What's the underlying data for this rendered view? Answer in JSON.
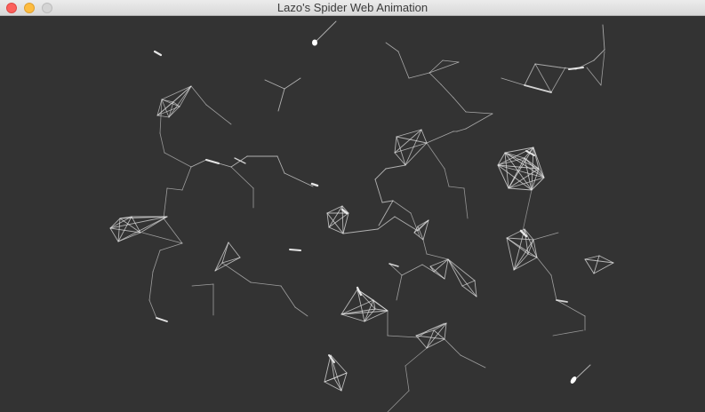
{
  "window": {
    "title": "Lazo's Spider Web Animation",
    "controls": {
      "close": {
        "icon": "close-icon",
        "color": "#fc605c"
      },
      "minimize": {
        "icon": "minimize-icon",
        "color": "#fdbc40"
      },
      "maximize": {
        "icon": "maximize-icon",
        "color": "#d4d4d4"
      }
    }
  },
  "canvas": {
    "background": "#333333",
    "line_color": "#e6e6e6",
    "node_color": "#ffffff"
  }
}
